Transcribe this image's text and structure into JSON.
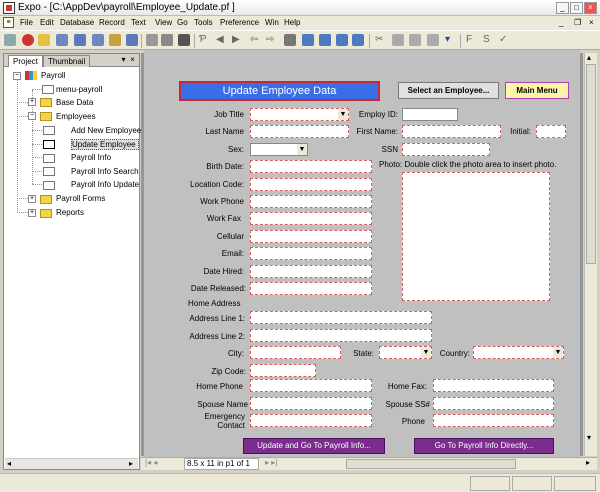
{
  "window": {
    "title": "Expo - [C:\\AppDev\\payroll\\Employee_Update.pf ]",
    "controls": [
      "_",
      "□",
      "×"
    ],
    "doc_controls": [
      "_",
      "❐",
      "×"
    ]
  },
  "menu": [
    "File",
    "Edit",
    "Database",
    "Record",
    "Text",
    "View",
    "Go",
    "Tools",
    "Preference",
    "Win",
    "Help"
  ],
  "panel": {
    "tabs": [
      "Project",
      "Thumbnail"
    ],
    "tree": {
      "root": "Payroll",
      "menu": "menu-payroll",
      "base": "Base Data",
      "employees": "Employees",
      "emp_children": [
        "Add New Employee",
        "Update Employee Data",
        "Payroll Info",
        "Payroll Info Search",
        "Payroll Info Update"
      ],
      "forms": "Payroll Forms",
      "reports": "Reports"
    }
  },
  "pageinfo": "8.5 x 11 in p1 of 1",
  "form": {
    "header": "Update Employee Data",
    "select_button": "Select an Employee...",
    "main_menu_button": "Main Menu",
    "labels": {
      "job_title": "Job Title",
      "employ_id": "Employ ID:",
      "last_name": "Last Name",
      "first_name": "First Name:",
      "initial": "Initial:",
      "sex": "Sex:",
      "ssn": "SSN",
      "birth_date": "Birth Date:",
      "photo": "Photo: Double click the photo area to insert photo.",
      "location_code": "Location Code:",
      "work_phone": "Work Phone",
      "work_fax": "Work Fax",
      "cellular": "Cellular",
      "email": "Email:",
      "date_hired": "Date Hired:",
      "date_released": "Date Released:",
      "home_address": "Home Address",
      "address1": "Address Line 1:",
      "address2": "Address Line 2:",
      "city": "City:",
      "state": "State:",
      "country": "Country:",
      "zip": "Zip Code:",
      "home_phone": "Home Phone",
      "home_fax": "Home Fax:",
      "spouse_name": "Spouse Name",
      "spouse_ss": "Spouse SS#",
      "emergency1": "Emergency",
      "emergency2": "Contact",
      "phone": "Phone"
    },
    "update_button": "Update and Go To Payroll Info...",
    "goto_button": "Go To Payroll Info Directly..."
  },
  "colors": {
    "header_bg": "#3a6ee8",
    "header_border": "#c8282f",
    "main_menu_bg": "#fff5a8",
    "purple_button": "#7a2d8c"
  }
}
